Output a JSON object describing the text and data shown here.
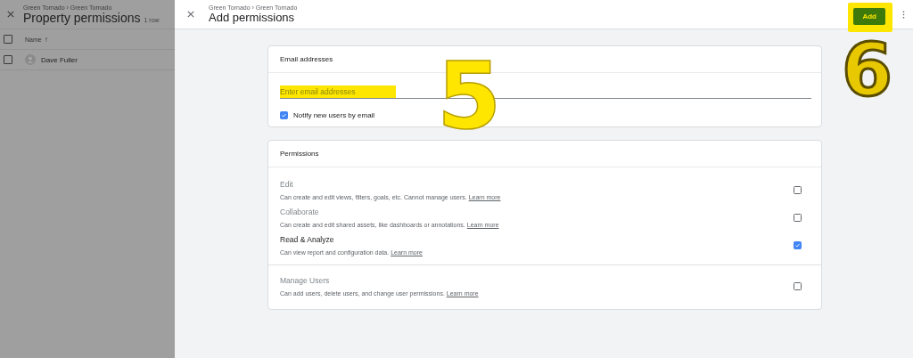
{
  "background_page": {
    "breadcrumb": "Green Tornado › Green Tornado",
    "title": "Property permissions",
    "count": "1 row",
    "columns": [
      {
        "label": "Name",
        "sort_icon": "↑"
      }
    ],
    "rows": [
      {
        "name": "Dave Fuller",
        "checked": false
      }
    ],
    "header_checked": false
  },
  "panel": {
    "breadcrumb": "Green Tornado › Green Tornado",
    "title": "Add permissions",
    "add_button": {
      "label": "Add",
      "highlighted": true
    }
  },
  "email_card": {
    "title": "Email addresses",
    "field": {
      "placeholder": "Enter email addresses",
      "highlighted": true
    },
    "notify": {
      "label": "Notify new users by email",
      "checked": true
    }
  },
  "permissions_card": {
    "title": "Permissions",
    "items": [
      {
        "title": "Edit",
        "description": "Can create and edit views, filters, goals, etc. Cannot manage users.",
        "link": "Learn more",
        "checked": false,
        "separated": false
      },
      {
        "title": "Collaborate",
        "description": "Can create and edit shared assets, like dashboards or annotations.",
        "link": "Learn more",
        "checked": false,
        "separated": false
      },
      {
        "title": "Read & Analyze",
        "description": "Can view report and configuration data.",
        "link": "Learn more",
        "checked": true,
        "separated": false
      },
      {
        "title": "Manage Users",
        "description": "Can add users, delete users, and change user permissions.",
        "link": "Learn more",
        "checked": false,
        "separated": true
      }
    ]
  },
  "annotations": [
    {
      "label": "5"
    },
    {
      "label": "6"
    }
  ]
}
